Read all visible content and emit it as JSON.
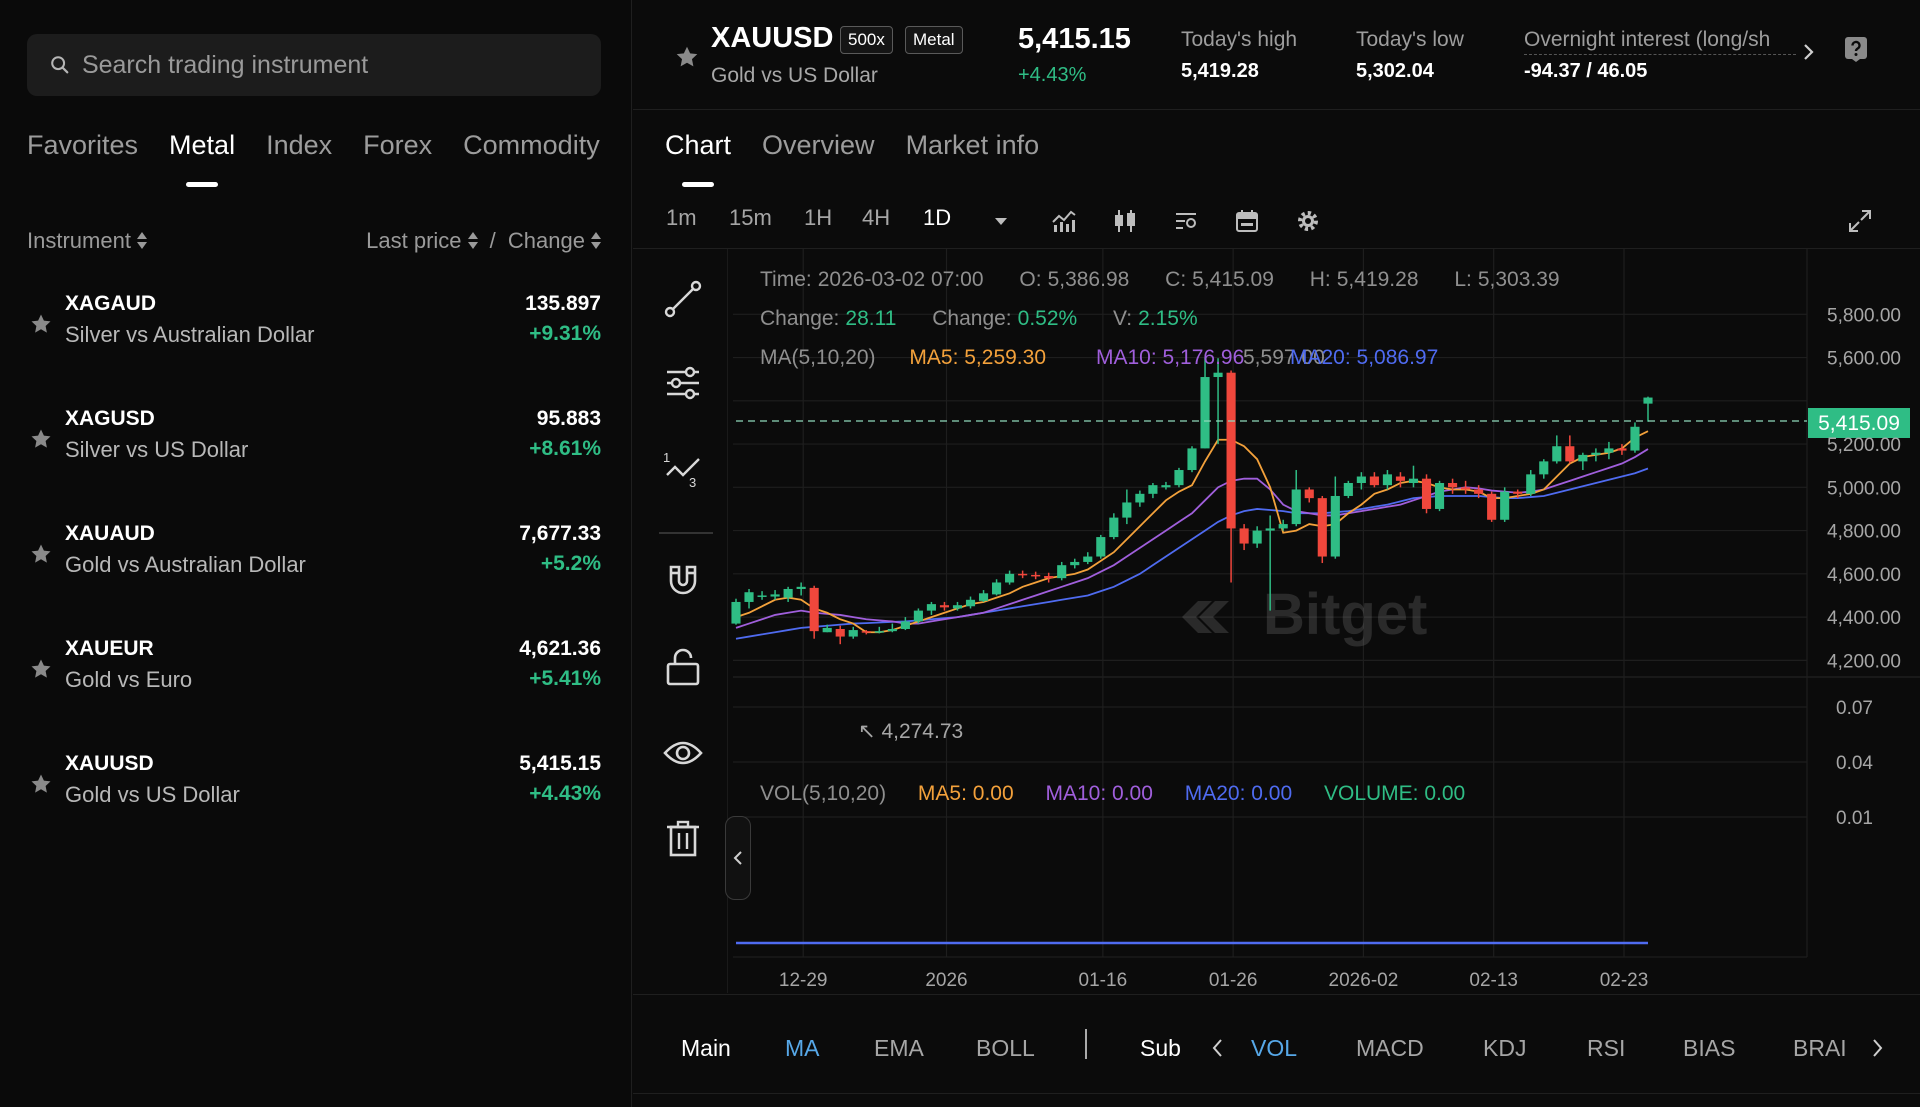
{
  "search": {
    "placeholder": "Search trading instrument"
  },
  "categories": [
    "Favorites",
    "Metal",
    "Index",
    "Forex",
    "Commodity"
  ],
  "active_category": "Metal",
  "list_header": {
    "instrument": "Instrument",
    "last_price": "Last price",
    "separator": "/",
    "change": "Change"
  },
  "instruments": [
    {
      "symbol": "XAGAUD",
      "name": "Silver vs Australian Dollar",
      "price": "135.897",
      "change": "+9.31%"
    },
    {
      "symbol": "XAGUSD",
      "name": "Silver vs US Dollar",
      "price": "95.883",
      "change": "+8.61%"
    },
    {
      "symbol": "XAUAUD",
      "name": "Gold vs Australian Dollar",
      "price": "7,677.33",
      "change": "+5.2%"
    },
    {
      "symbol": "XAUEUR",
      "name": "Gold vs Euro",
      "price": "4,621.36",
      "change": "+5.41%"
    },
    {
      "symbol": "XAUUSD",
      "name": "Gold vs US Dollar",
      "price": "5,415.15",
      "change": "+4.43%"
    }
  ],
  "header": {
    "symbol": "XAUUSD",
    "leverage": "500x",
    "category_tag": "Metal",
    "name": "Gold vs US Dollar",
    "price": "5,415.15",
    "change": "+4.43%",
    "high_label": "Today's high",
    "high_value": "5,419.28",
    "low_label": "Today's low",
    "low_value": "5,302.04",
    "overnight_label": "Overnight interest (long/sh",
    "overnight_value": "-94.37 / 46.05"
  },
  "view_tabs": [
    "Chart",
    "Overview",
    "Market info"
  ],
  "active_view": "Chart",
  "intervals": [
    "1m",
    "15m",
    "1H",
    "4H",
    "1D"
  ],
  "active_interval": "1D",
  "toolbar_icons": [
    "indicators-icon",
    "candle-type-icon",
    "chart-settings-list-icon",
    "calendar-icon",
    "gear-icon",
    "fullscreen-icon"
  ],
  "drawing_tools": [
    "trend-line-icon",
    "adjust-sliders-icon",
    "fibonacci-icon",
    "magnet-icon",
    "lock-icon",
    "eye-icon",
    "trash-icon"
  ],
  "chart_info": {
    "time_label": "Time:",
    "time": "2026-03-02 07:00",
    "open_label": "O:",
    "open": "5,386.98",
    "close_label": "C:",
    "close": "5,415.09",
    "high_label": "H:",
    "high": "5,419.28",
    "low_label": "L:",
    "low": "5,303.39",
    "change_label": "Change:",
    "change": "28.11",
    "change_pct_label": "Change:",
    "change_pct": "0.52%",
    "vol_label": "V:",
    "vol": "2.15%",
    "ma_label": "MA(5,10,20)",
    "ma5": "MA5: 5,259.30",
    "ma10": "MA10: 5,176.96",
    "ma20": "MA20: 5,086.97",
    "peak_label": "5,597.00",
    "low_mark": "4,274.73",
    "current_price_tag": "5,415.09",
    "watermark": "Bitget"
  },
  "volume_info": {
    "label": "VOL(5,10,20)",
    "ma5": "MA5: 0.00",
    "ma10": "MA10: 0.00",
    "ma20": "MA20: 0.00",
    "volume": "VOLUME: 0.00"
  },
  "bottom_bar": {
    "main": "Main",
    "main_items": [
      "MA",
      "EMA",
      "BOLL"
    ],
    "sub": "Sub",
    "sub_items": [
      "VOL",
      "MACD",
      "KDJ",
      "RSI",
      "BIAS",
      "BRAI"
    ]
  },
  "colors": {
    "up": "#2fbd85",
    "down": "#f0473c",
    "ma5": "#f3a13b",
    "ma10": "#a05fdc",
    "ma20": "#4f6bf0",
    "accent": "#57a8e8"
  },
  "chart_data": {
    "type": "candlestick",
    "price_axis_ticks": [
      "5,800.00",
      "5,600.00",
      "5,200.00",
      "5,000.00",
      "4,800.00",
      "4,600.00",
      "4,400.00",
      "4,200.00"
    ],
    "volume_axis_ticks": [
      "0.07",
      "0.04",
      "0.01"
    ],
    "time_axis_ticks": [
      "12-29",
      "2026",
      "01-16",
      "01-26",
      "2026-02",
      "02-13",
      "02-23"
    ],
    "ylim": [
      4160,
      5880
    ],
    "candles": [
      {
        "o": 4370,
        "c": 4470,
        "h": 4485,
        "l": 4365
      },
      {
        "o": 4470,
        "c": 4515,
        "h": 4530,
        "l": 4440
      },
      {
        "o": 4500,
        "c": 4500,
        "h": 4520,
        "l": 4480
      },
      {
        "o": 4495,
        "c": 4505,
        "h": 4525,
        "l": 4480
      },
      {
        "o": 4490,
        "c": 4530,
        "h": 4540,
        "l": 4470
      },
      {
        "o": 4530,
        "c": 4540,
        "h": 4560,
        "l": 4500
      },
      {
        "o": 4535,
        "c": 4335,
        "h": 4545,
        "l": 4300
      },
      {
        "o": 4330,
        "c": 4350,
        "h": 4365,
        "l": 4330
      },
      {
        "o": 4345,
        "c": 4310,
        "h": 4360,
        "l": 4274.73
      },
      {
        "o": 4310,
        "c": 4340,
        "h": 4355,
        "l": 4300
      },
      {
        "o": 4335,
        "c": 4330,
        "h": 4340,
        "l": 4320
      },
      {
        "o": 4330,
        "c": 4335,
        "h": 4355,
        "l": 4325
      },
      {
        "o": 4335,
        "c": 4345,
        "h": 4370,
        "l": 4330
      },
      {
        "o": 4345,
        "c": 4380,
        "h": 4400,
        "l": 4340
      },
      {
        "o": 4380,
        "c": 4430,
        "h": 4440,
        "l": 4370
      },
      {
        "o": 4430,
        "c": 4460,
        "h": 4470,
        "l": 4410
      },
      {
        "o": 4455,
        "c": 4445,
        "h": 4470,
        "l": 4430
      },
      {
        "o": 4440,
        "c": 4455,
        "h": 4470,
        "l": 4430
      },
      {
        "o": 4450,
        "c": 4480,
        "h": 4495,
        "l": 4440
      },
      {
        "o": 4475,
        "c": 4510,
        "h": 4525,
        "l": 4470
      },
      {
        "o": 4505,
        "c": 4560,
        "h": 4575,
        "l": 4500
      },
      {
        "o": 4560,
        "c": 4600,
        "h": 4615,
        "l": 4550
      },
      {
        "o": 4600,
        "c": 4595,
        "h": 4615,
        "l": 4580
      },
      {
        "o": 4595,
        "c": 4590,
        "h": 4610,
        "l": 4575
      },
      {
        "o": 4590,
        "c": 4580,
        "h": 4605,
        "l": 4560
      },
      {
        "o": 4580,
        "c": 4640,
        "h": 4655,
        "l": 4570
      },
      {
        "o": 4640,
        "c": 4655,
        "h": 4670,
        "l": 4625
      },
      {
        "o": 4655,
        "c": 4680,
        "h": 4700,
        "l": 4645
      },
      {
        "o": 4680,
        "c": 4770,
        "h": 4780,
        "l": 4670
      },
      {
        "o": 4770,
        "c": 4860,
        "h": 4880,
        "l": 4760
      },
      {
        "o": 4860,
        "c": 4930,
        "h": 4990,
        "l": 4830
      },
      {
        "o": 4930,
        "c": 4970,
        "h": 4985,
        "l": 4910
      },
      {
        "o": 4970,
        "c": 5010,
        "h": 5020,
        "l": 4950
      },
      {
        "o": 5000,
        "c": 5010,
        "h": 5025,
        "l": 4990
      },
      {
        "o": 5010,
        "c": 5080,
        "h": 5090,
        "l": 5000
      },
      {
        "o": 5080,
        "c": 5180,
        "h": 5190,
        "l": 5070
      },
      {
        "o": 5180,
        "c": 5510,
        "h": 5600,
        "l": 5180
      },
      {
        "o": 5510,
        "c": 5530,
        "h": 5597,
        "l": 5200
      },
      {
        "o": 5530,
        "c": 4810,
        "h": 5540,
        "l": 4560
      },
      {
        "o": 4810,
        "c": 4740,
        "h": 4830,
        "l": 4710
      },
      {
        "o": 4740,
        "c": 4800,
        "h": 4820,
        "l": 4720
      },
      {
        "o": 4800,
        "c": 4810,
        "h": 4870,
        "l": 4430
      },
      {
        "o": 4810,
        "c": 4830,
        "h": 4850,
        "l": 4800
      },
      {
        "o": 4830,
        "c": 4990,
        "h": 5080,
        "l": 4820
      },
      {
        "o": 4990,
        "c": 4950,
        "h": 5000,
        "l": 4930
      },
      {
        "o": 4950,
        "c": 4680,
        "h": 4960,
        "l": 4650
      },
      {
        "o": 4680,
        "c": 4960,
        "h": 5050,
        "l": 4670
      },
      {
        "o": 4960,
        "c": 5020,
        "h": 5030,
        "l": 4950
      },
      {
        "o": 5020,
        "c": 5050,
        "h": 5070,
        "l": 4990
      },
      {
        "o": 5050,
        "c": 5010,
        "h": 5070,
        "l": 5000
      },
      {
        "o": 5010,
        "c": 5060,
        "h": 5080,
        "l": 4990
      },
      {
        "o": 5050,
        "c": 5030,
        "h": 5070,
        "l": 5000
      },
      {
        "o": 5020,
        "c": 5040,
        "h": 5100,
        "l": 5000
      },
      {
        "o": 5040,
        "c": 4900,
        "h": 5060,
        "l": 4880
      },
      {
        "o": 4900,
        "c": 5020,
        "h": 5030,
        "l": 4890
      },
      {
        "o": 5020,
        "c": 5000,
        "h": 5040,
        "l": 4970
      },
      {
        "o": 5000,
        "c": 4990,
        "h": 5030,
        "l": 4970
      },
      {
        "o": 4990,
        "c": 4970,
        "h": 5010,
        "l": 4950
      },
      {
        "o": 4970,
        "c": 4850,
        "h": 4980,
        "l": 4840
      },
      {
        "o": 4850,
        "c": 4980,
        "h": 5000,
        "l": 4840
      },
      {
        "o": 4980,
        "c": 4970,
        "h": 4990,
        "l": 4950
      },
      {
        "o": 4970,
        "c": 5060,
        "h": 5080,
        "l": 4960
      },
      {
        "o": 5060,
        "c": 5120,
        "h": 5130,
        "l": 5040
      },
      {
        "o": 5120,
        "c": 5190,
        "h": 5240,
        "l": 5110
      },
      {
        "o": 5190,
        "c": 5120,
        "h": 5240,
        "l": 5110
      },
      {
        "o": 5120,
        "c": 5150,
        "h": 5160,
        "l": 5080
      },
      {
        "o": 5150,
        "c": 5160,
        "h": 5180,
        "l": 5120
      },
      {
        "o": 5160,
        "c": 5180,
        "h": 5210,
        "l": 5130
      },
      {
        "o": 5180,
        "c": 5170,
        "h": 5200,
        "l": 5150
      },
      {
        "o": 5170,
        "c": 5280,
        "h": 5300,
        "l": 5160
      },
      {
        "o": 5386.98,
        "c": 5415.09,
        "h": 5419.28,
        "l": 5303.39
      }
    ],
    "ma5": [
      4400,
      4420,
      4450,
      4480,
      4490,
      4480,
      4440,
      4420,
      4390,
      4370,
      4330,
      4330,
      4340,
      4360,
      4380,
      4400,
      4420,
      4440,
      4460,
      4470,
      4490,
      4510,
      4540,
      4560,
      4580,
      4590,
      4600,
      4620,
      4660,
      4700,
      4760,
      4820,
      4880,
      4940,
      4980,
      5010,
      5120,
      5220,
      5220,
      5190,
      5130,
      5000,
      4790,
      4800,
      4830,
      4820,
      4830,
      4880,
      4920,
      4970,
      4990,
      5020,
      5030,
      5020,
      5000,
      4990,
      4990,
      4980,
      4950,
      4950,
      4960,
      4970,
      4990,
      5050,
      5110,
      5140,
      5150,
      5160,
      5180,
      5230,
      5259.3
    ],
    "ma10": [
      4350,
      4370,
      4390,
      4410,
      4420,
      4430,
      4420,
      4415,
      4410,
      4400,
      4390,
      4385,
      4380,
      4370,
      4370,
      4380,
      4390,
      4400,
      4410,
      4420,
      4440,
      4460,
      4480,
      4500,
      4520,
      4540,
      4560,
      4580,
      4610,
      4640,
      4680,
      4720,
      4760,
      4800,
      4840,
      4880,
      4940,
      5000,
      5030,
      5040,
      5040,
      4990,
      4920,
      4890,
      4880,
      4870,
      4870,
      4880,
      4890,
      4900,
      4910,
      4920,
      4940,
      4960,
      4980,
      4990,
      5000,
      4995,
      4985,
      4980,
      4975,
      4980,
      4990,
      5010,
      5030,
      5050,
      5070,
      5090,
      5110,
      5140,
      5176.96
    ],
    "ma20": [
      4300,
      4310,
      4320,
      4330,
      4340,
      4350,
      4355,
      4360,
      4365,
      4370,
      4372,
      4375,
      4378,
      4380,
      4385,
      4390,
      4395,
      4400,
      4410,
      4420,
      4430,
      4440,
      4450,
      4460,
      4470,
      4480,
      4490,
      4500,
      4520,
      4540,
      4570,
      4600,
      4640,
      4680,
      4720,
      4760,
      4800,
      4840,
      4870,
      4890,
      4900,
      4895,
      4890,
      4880,
      4880,
      4880,
      4885,
      4890,
      4900,
      4910,
      4920,
      4935,
      4950,
      4955,
      4960,
      4960,
      4960,
      4960,
      4955,
      4950,
      4950,
      4955,
      4960,
      4975,
      4990,
      5005,
      5020,
      5035,
      5050,
      5065,
      5086.97
    ]
  }
}
